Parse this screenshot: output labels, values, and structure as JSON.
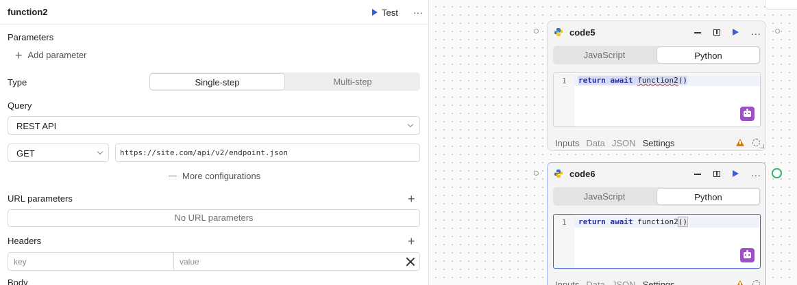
{
  "panel": {
    "title": "function2",
    "test_label": "Test",
    "more_label": "···",
    "parameters_label": "Parameters",
    "add_parameter_label": "Add parameter",
    "type_label": "Type",
    "type_options": [
      "Single-step",
      "Multi-step"
    ],
    "type_selected": "Single-step",
    "query_label": "Query",
    "query_value": "REST API",
    "method_value": "GET",
    "url_value": "https://site.com/api/v2/endpoint.json",
    "more_configurations_label": "More configurations",
    "url_parameters_label": "URL parameters",
    "no_url_parameters_label": "No URL parameters",
    "headers_label": "Headers",
    "header_key_placeholder": "key",
    "header_value_placeholder": "value",
    "body_label": "Body"
  },
  "canvas": {
    "nodes": [
      {
        "title": "code5",
        "lang_options": [
          "JavaScript",
          "Python"
        ],
        "lang_selected": "Python",
        "line_number": "1",
        "code_keyword1": "return",
        "code_keyword2": "await",
        "code_call": "function2",
        "code_parens": "()",
        "tabs": [
          "Inputs",
          "Data",
          "JSON",
          "Settings"
        ],
        "active_tab": "Settings",
        "more_label": "···"
      },
      {
        "title": "code6",
        "lang_options": [
          "JavaScript",
          "Python"
        ],
        "lang_selected": "Python",
        "line_number": "1",
        "code_keyword1": "return",
        "code_keyword2": "await",
        "code_call": "function2",
        "code_parens": "()",
        "tabs": [
          "Inputs",
          "Data",
          "JSON",
          "Settings"
        ],
        "active_tab": "Settings",
        "more_label": "···"
      }
    ]
  },
  "colors": {
    "accent": "#3b5bdb",
    "ai_purple": "#9b51c4",
    "warning": "#e07b00",
    "connected_green": "#2fb36b"
  },
  "icons": [
    "play-icon",
    "more-dots-icon",
    "plus-icon",
    "chevron-down-icon",
    "dash-icon",
    "close-icon",
    "python-icon",
    "minimize-icon",
    "side-panel-icon",
    "run-icon",
    "ai-assistant-icon",
    "warning-icon",
    "loading-icon",
    "resize-icon"
  ]
}
